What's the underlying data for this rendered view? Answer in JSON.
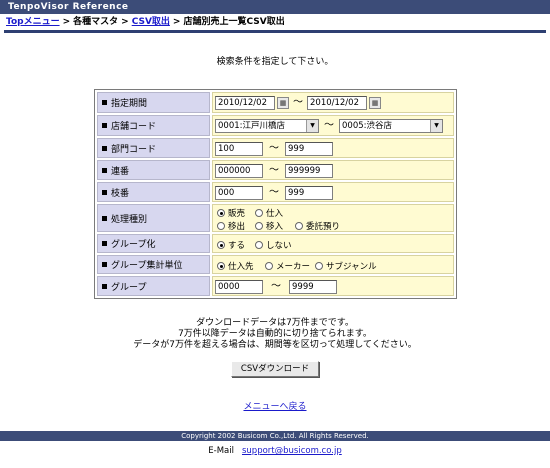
{
  "app_title": "TenpoVisor Reference",
  "breadcrumb": {
    "top": "Topメニュー",
    "sep": ">",
    "master": "各種マスタ",
    "csv": "CSV取出",
    "current": "店舗別売上一覧CSV取出"
  },
  "instruction": "検索条件を指定して下さい。",
  "form": {
    "period_label": "指定期間",
    "period_from": "2010/12/02",
    "period_to": "2010/12/02",
    "store_label": "店舗コード",
    "store_from": "0001:江戸川橋店",
    "store_to": "0005:渋谷店",
    "dept_label": "部門コード",
    "dept_from": "100",
    "dept_to": "999",
    "series_label": "連番",
    "series_from": "000000",
    "series_to": "999999",
    "branch_label": "枝番",
    "branch_from": "000",
    "branch_to": "999",
    "process_label": "処理種別",
    "process_opts": [
      "販売",
      "仕入",
      "移出",
      "移入",
      "委託預り"
    ],
    "group_flag_label": "グループ化",
    "group_flag_opts": [
      "する",
      "しない"
    ],
    "agg_label": "グループ集計単位",
    "agg_opts": [
      "仕入先",
      "メーカー",
      "サブジャンル"
    ],
    "group_label": "グループ",
    "group_from": "0000",
    "group_to": "9999",
    "tilde": "〜"
  },
  "notes": [
    "ダウンロードデータは7万件までです。",
    "7万件以降データは自動的に切り捨てられます。",
    "データが7万件を超える場合は、期間等を区切って処理してください。"
  ],
  "download_button": "CSVダウンロード",
  "back_link": "メニューへ戻る",
  "copyright": "Copyright 2002 Busicom Co.,Ltd. All Rights Reserved.",
  "email_label": "E-Mail",
  "email": "support@busicom.co.jp"
}
